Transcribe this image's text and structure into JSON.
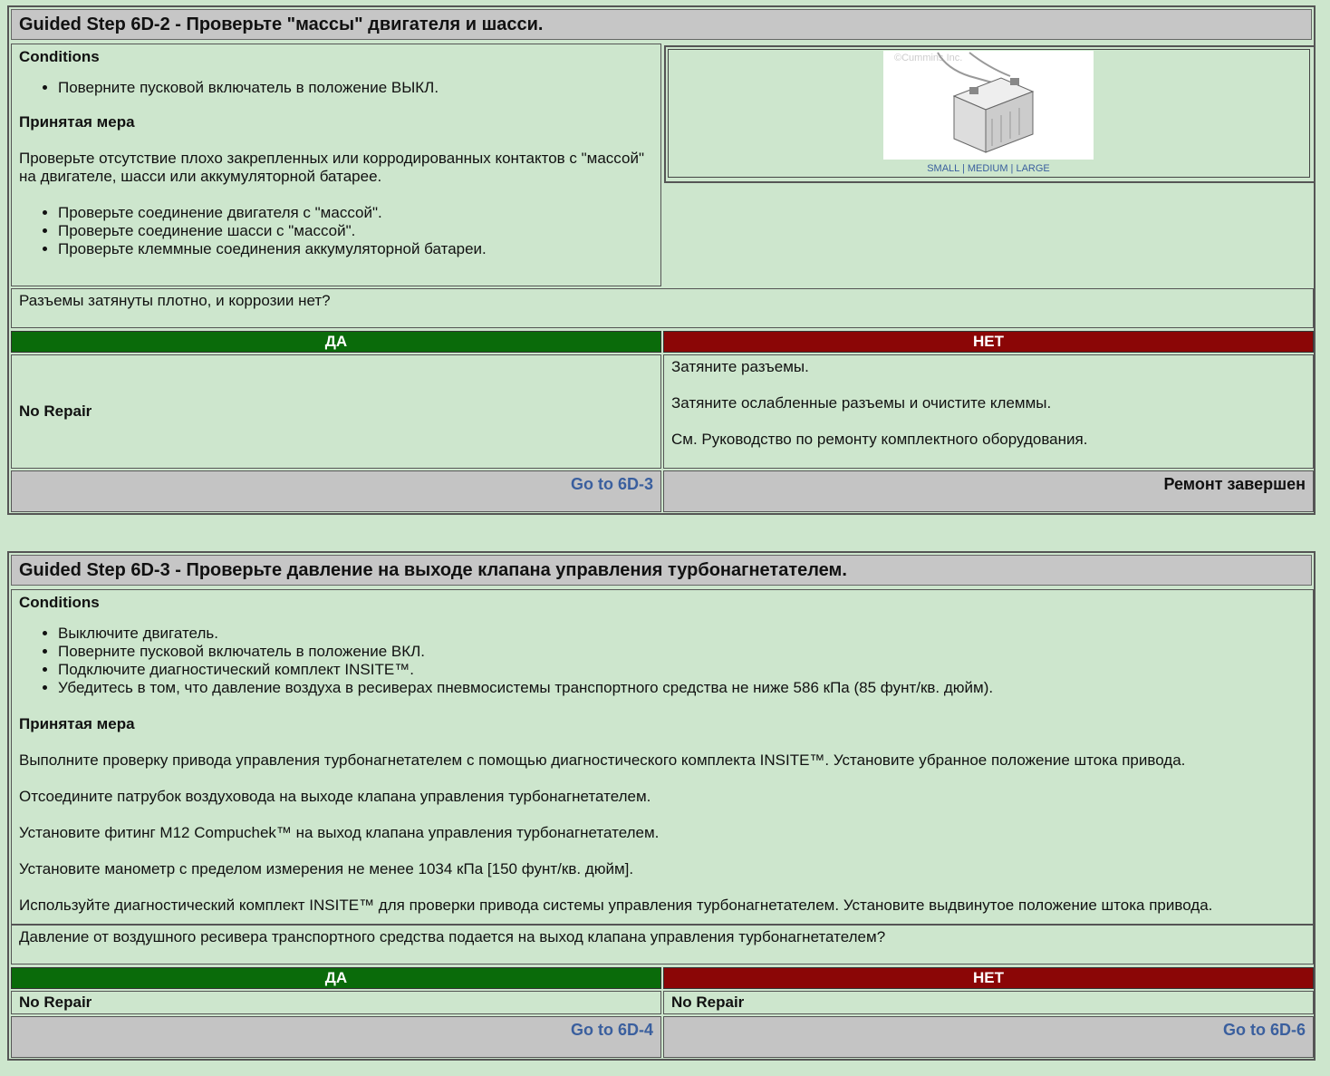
{
  "step1": {
    "title": "Guided Step 6D-2 - Проверьте \"массы\" двигателя и шасси.",
    "conditions_label": "Conditions",
    "conditions": [
      "Поверните пусковой включатель в положение ВЫКЛ."
    ],
    "action_label": "Принятая мера",
    "action_text": "Проверьте отсутствие плохо закрепленных или корродированных контактов с \"массой\" на двигателе, шасси или аккумуляторной батарее.",
    "action_items": [
      "Проверьте соединение двигателя с \"массой\".",
      "Проверьте соединение шасси с \"массой\".",
      "Проверьте клеммные соединения аккумуляторной батареи."
    ],
    "image": {
      "watermark": "©Cummins Inc.",
      "size_links": [
        "SMALL",
        "MEDIUM",
        "LARGE"
      ]
    },
    "question": "Разъемы затянуты плотно, и коррозии нет?",
    "yes_label": "ДА",
    "no_label": "НЕТ",
    "yes_result": "No Repair",
    "no_result_lines": [
      "Затяните разъемы.",
      "Затяните ослабленные разъемы и очистите клеммы.",
      "См. Руководство по ремонту комплектного оборудования."
    ],
    "yes_link": "Go to 6D-3",
    "no_link": "Ремонт завершен"
  },
  "step2": {
    "title": "Guided Step 6D-3 - Проверьте давление на выходе клапана управления турбонагнетателем.",
    "conditions_label": "Conditions",
    "conditions": [
      "Выключите двигатель.",
      "Поверните пусковой включатель в положение ВКЛ.",
      "Подключите диагностический комплект INSITE™.",
      "Убедитесь в том, что давление воздуха в ресиверах пневмосистемы транспортного средства не ниже 586 кПа (85 фунт/кв. дюйм)."
    ],
    "action_label": "Принятая мера",
    "action_paragraphs": [
      "Выполните проверку привода управления турбонагнетателем с помощью диагностического комплекта INSITE™. Установите убранное положение штока привода.",
      "Отсоедините патрубок воздуховода на выходе клапана управления турбонагнетателем.",
      "Установите фитинг M12 Compuchek™ на выход клапана управления турбонагнетателем.",
      "Установите манометр с пределом измерения не менее 1034 кПа [150 фунт/кв. дюйм].",
      "Используйте диагностический комплект INSITE™ для проверки привода системы управления турбонагнетателем. Установите выдвинутое положение штока привода."
    ],
    "question": "Давление от воздушного ресивера транспортного средства подается на выход клапана управления турбонагнетателем?",
    "yes_label": "ДА",
    "no_label": "НЕТ",
    "yes_result": "No Repair",
    "no_result": "No Repair",
    "yes_link": "Go to 6D-4",
    "no_link": "Go to 6D-6"
  }
}
